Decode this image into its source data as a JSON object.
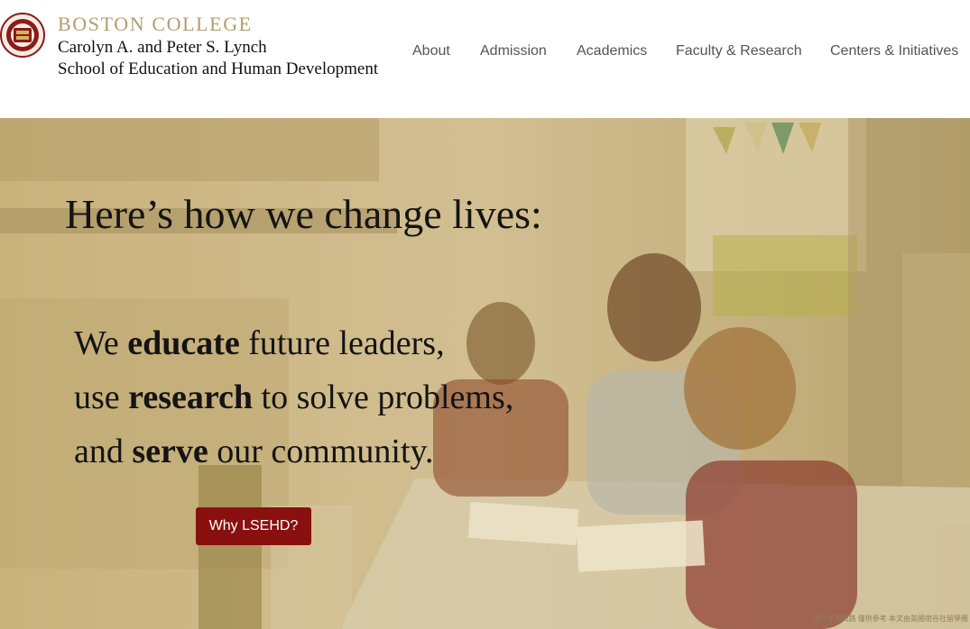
{
  "header": {
    "institution": "BOSTON COLLEGE",
    "school_line1": "Carolyn A. and Peter S. Lynch",
    "school_line2": "School of Education and Human Development",
    "seal_icon": "bc-seal-icon"
  },
  "nav": {
    "items": [
      {
        "label": "About"
      },
      {
        "label": "Admission"
      },
      {
        "label": "Academics"
      },
      {
        "label": "Faculty & Research"
      },
      {
        "label": "Centers & Initiatives"
      }
    ]
  },
  "hero": {
    "title": "Here’s how we change lives:",
    "lines": [
      {
        "pre": "We ",
        "bold": "educate",
        "post": " future leaders,"
      },
      {
        "pre": "use ",
        "bold": "research",
        "post": " to solve problems,"
      },
      {
        "pre": "and ",
        "bold": "serve",
        "post": " our community."
      }
    ],
    "cta_label": "Why LSEHD?",
    "credit": "圖片來源網路    僅供參考    本文由英國宿谷社留學團"
  },
  "colors": {
    "brand_gold": "#b29d6c",
    "cta_red": "#8a1010",
    "hero_tint": "#cbb88c"
  }
}
